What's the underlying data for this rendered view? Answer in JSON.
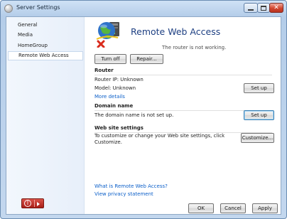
{
  "window": {
    "title": "Server Settings",
    "controls": {
      "minimize_icon": "minimize-icon",
      "maximize_icon": "maximize-icon",
      "close_icon": "close-icon"
    }
  },
  "sidebar": {
    "items": [
      {
        "label": "General",
        "active": false
      },
      {
        "label": "Media",
        "active": false
      },
      {
        "label": "HomeGroup",
        "active": false
      },
      {
        "label": "Remote Web Access",
        "active": true
      }
    ],
    "power_icon": "power-icon"
  },
  "main": {
    "title": "Remote Web Access",
    "status": "The router is not working.",
    "hero_icon": "globe-with-error-icon",
    "buttons": {
      "turn_off": "Turn off",
      "repair": "Repair..."
    },
    "router": {
      "heading": "Router",
      "ip": "Router IP: Unknown",
      "model": "Model: Unknown",
      "more_details": "More details",
      "setup": "Set up"
    },
    "domain": {
      "heading": "Domain name",
      "message": "The domain name is not set up.",
      "setup": "Set up"
    },
    "website": {
      "heading": "Web site settings",
      "line1": "To customize or change your Web site settings, click",
      "line2": "Customize.",
      "customize": "Customize..."
    },
    "links": {
      "what_is": "What is Remote Web Access?",
      "privacy": "View privacy statement"
    }
  },
  "footer": {
    "ok": "OK",
    "cancel": "Cancel",
    "apply": "Apply"
  },
  "colors": {
    "title_blue": "#1d3f82",
    "link_blue": "#0b5fc9",
    "power_red": "#c4291e",
    "frame_blue": "#b4cde9"
  }
}
